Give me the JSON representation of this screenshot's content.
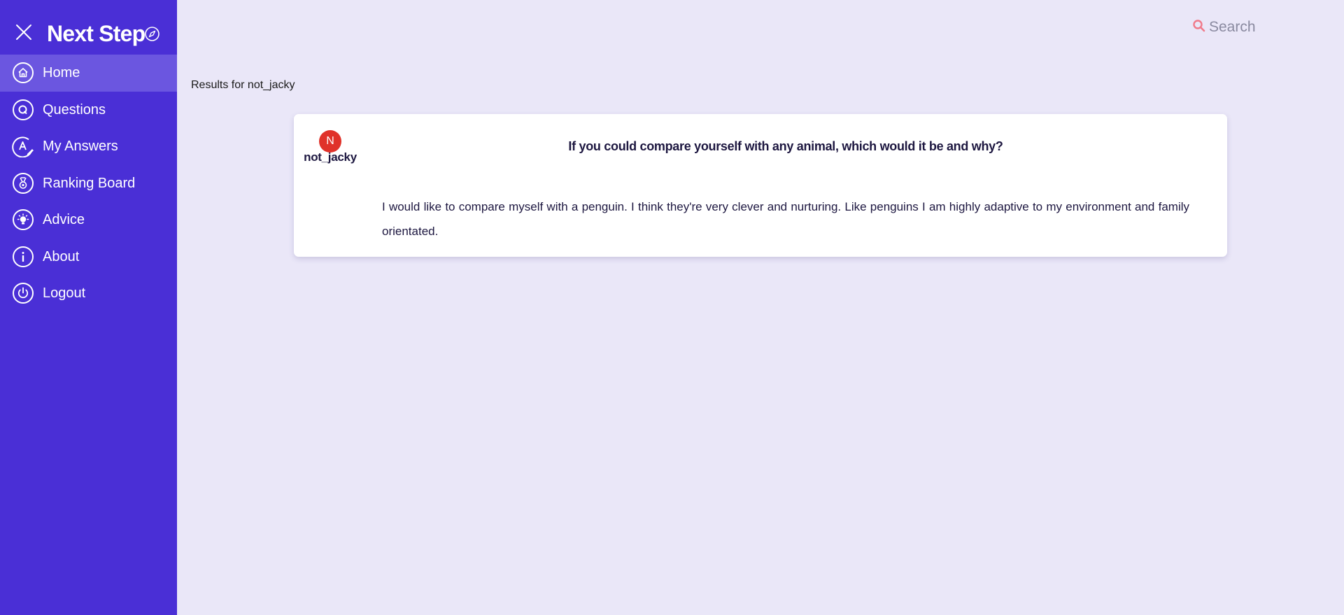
{
  "app": {
    "title": "Next Step",
    "close_icon": "close-icon",
    "brand_icon": "compass-icon"
  },
  "sidebar": {
    "items": [
      {
        "label": "Home",
        "icon": "home-icon",
        "active": true
      },
      {
        "label": "Questions",
        "icon": "question-q-icon",
        "active": false
      },
      {
        "label": "My Answers",
        "icon": "answer-edit-icon",
        "active": false
      },
      {
        "label": "Ranking Board",
        "icon": "medal-icon",
        "active": false
      },
      {
        "label": "Advice",
        "icon": "lightbulb-icon",
        "active": false
      },
      {
        "label": "About",
        "icon": "info-icon",
        "active": false
      },
      {
        "label": "Logout",
        "icon": "power-icon",
        "active": false
      }
    ]
  },
  "search": {
    "placeholder": "Search",
    "icon": "search-icon"
  },
  "main": {
    "results_label": "Results for not_jacky",
    "result": {
      "avatar_initial": "N",
      "username": "not_jacky",
      "question": "If you could compare yourself with any animal, which would it be and why?",
      "answer": "I would like to compare myself with a penguin. I think they're very clever and nurturing. Like penguins I am highly adaptive to my environment and family orientated."
    }
  },
  "colors": {
    "sidebar_bg": "#4a2fd6",
    "sidebar_active": "#6b56e0",
    "page_bg": "#eae7f8",
    "avatar_bg": "#e0322a",
    "search_icon": "#f07a8a",
    "text_dark": "#1d1740"
  }
}
